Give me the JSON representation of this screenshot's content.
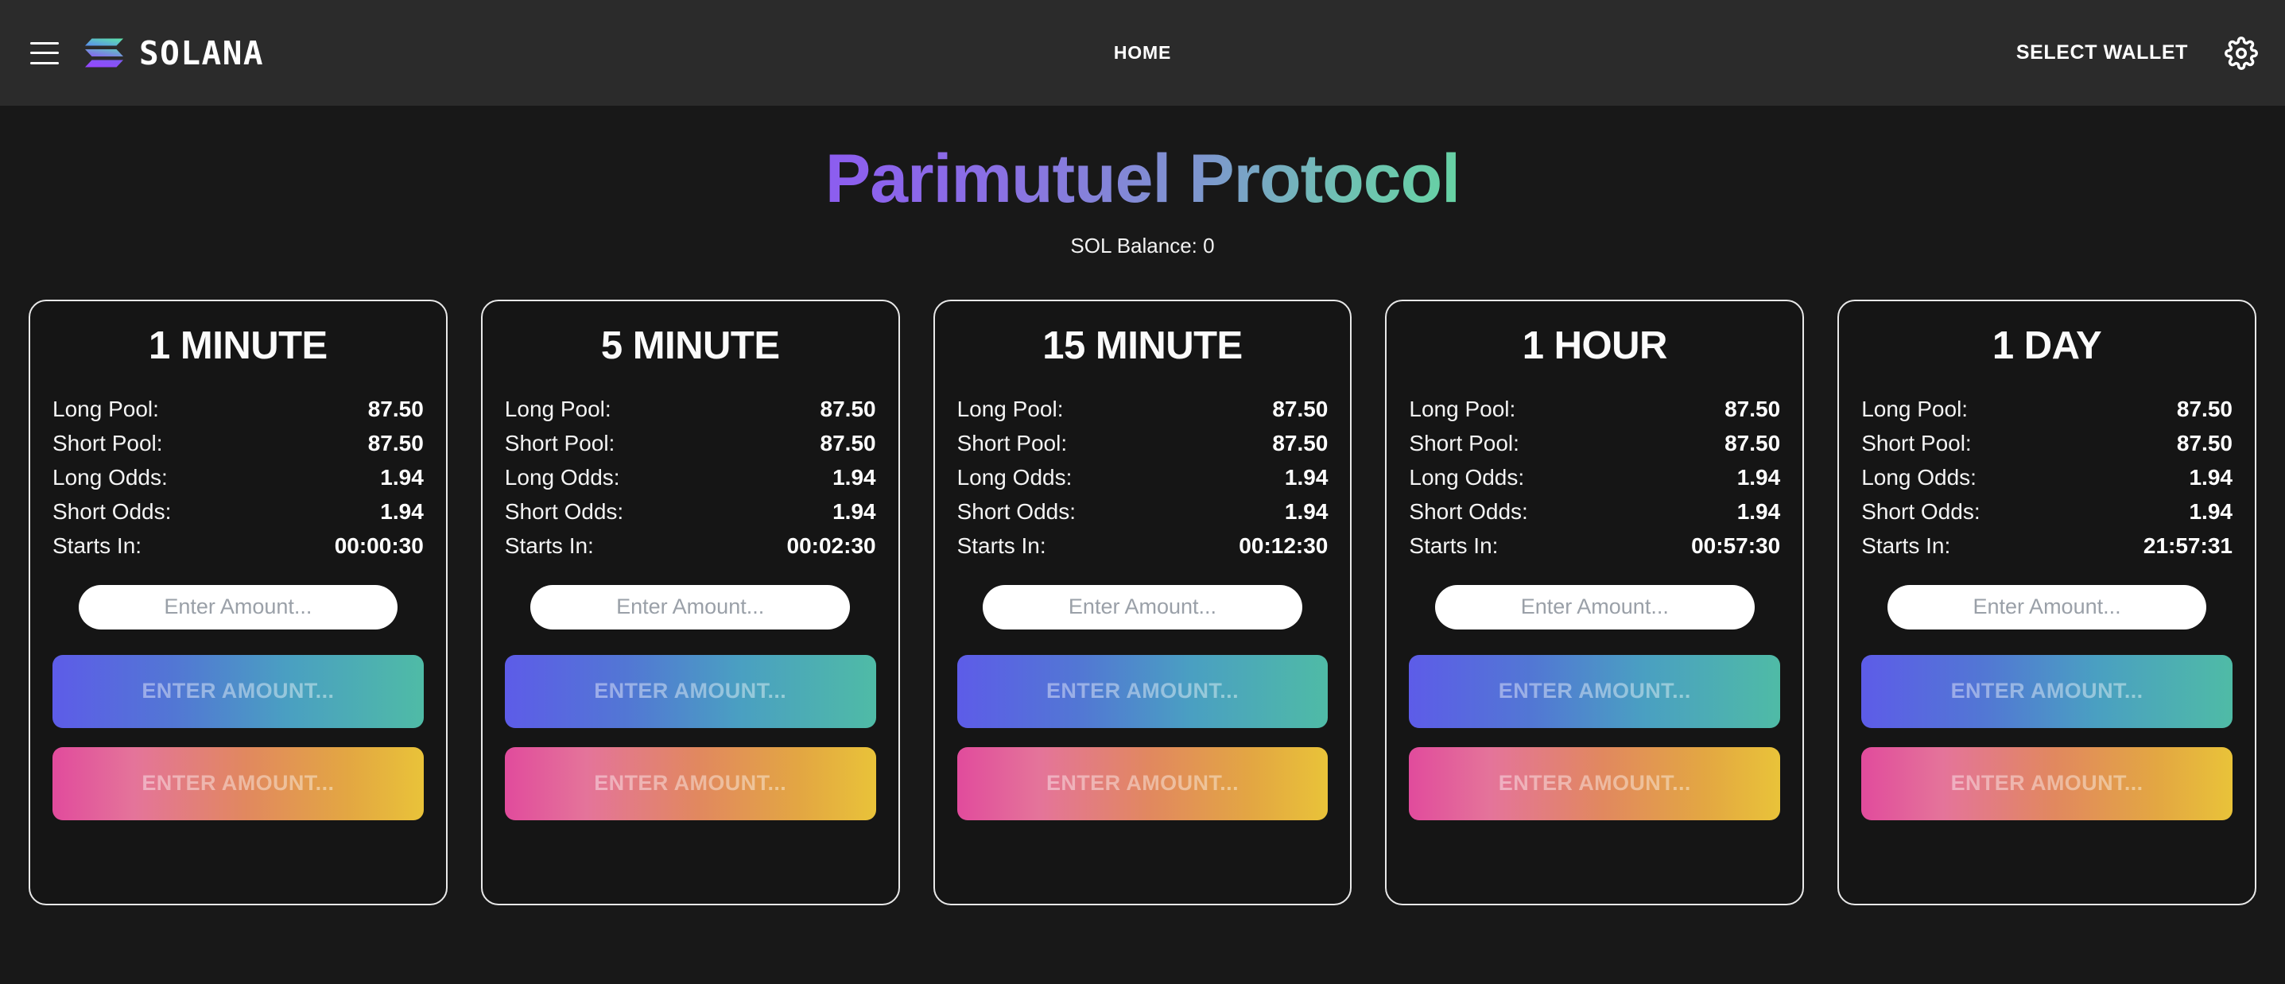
{
  "navbar": {
    "menu_icon": "hamburger-menu-icon",
    "brand": "SOLANA",
    "brand_logo_icon": "solana-logo-icon",
    "home_link": "HOME",
    "select_wallet": "SELECT WALLET",
    "settings_icon": "gear-icon"
  },
  "hero": {
    "title": "Parimutuel Protocol",
    "balance": "SOL Balance: 0"
  },
  "labels": {
    "long_pool": "Long Pool:",
    "short_pool": "Short Pool:",
    "long_odds": "Long Odds:",
    "short_odds": "Short Odds:",
    "starts_in": "Starts In:",
    "input_placeholder": "Enter Amount...",
    "long_button": "ENTER AMOUNT...",
    "short_button": "ENTER AMOUNT..."
  },
  "colors": {
    "navbar_bg": "#2b2b2b",
    "page_bg": "#181818",
    "card_bg": "#151515",
    "card_border": "#e8e8e8",
    "title_gradient_start": "#8c5cf0",
    "title_gradient_end": "#66d3a3",
    "long_gradient_start": "#5d5ce8",
    "long_gradient_end": "#4fbba6",
    "short_gradient_start": "#e14b9c",
    "short_gradient_end": "#e9c339"
  },
  "cards": [
    {
      "title": "1 MINUTE",
      "long_pool": "87.50",
      "short_pool": "87.50",
      "long_odds": "1.94",
      "short_odds": "1.94",
      "starts_in": "00:00:30",
      "input_value": ""
    },
    {
      "title": "5 MINUTE",
      "long_pool": "87.50",
      "short_pool": "87.50",
      "long_odds": "1.94",
      "short_odds": "1.94",
      "starts_in": "00:02:30",
      "input_value": ""
    },
    {
      "title": "15 MINUTE",
      "long_pool": "87.50",
      "short_pool": "87.50",
      "long_odds": "1.94",
      "short_odds": "1.94",
      "starts_in": "00:12:30",
      "input_value": ""
    },
    {
      "title": "1 HOUR",
      "long_pool": "87.50",
      "short_pool": "87.50",
      "long_odds": "1.94",
      "short_odds": "1.94",
      "starts_in": "00:57:30",
      "input_value": ""
    },
    {
      "title": "1 DAY",
      "long_pool": "87.50",
      "short_pool": "87.50",
      "long_odds": "1.94",
      "short_odds": "1.94",
      "starts_in": "21:57:31",
      "input_value": ""
    }
  ]
}
